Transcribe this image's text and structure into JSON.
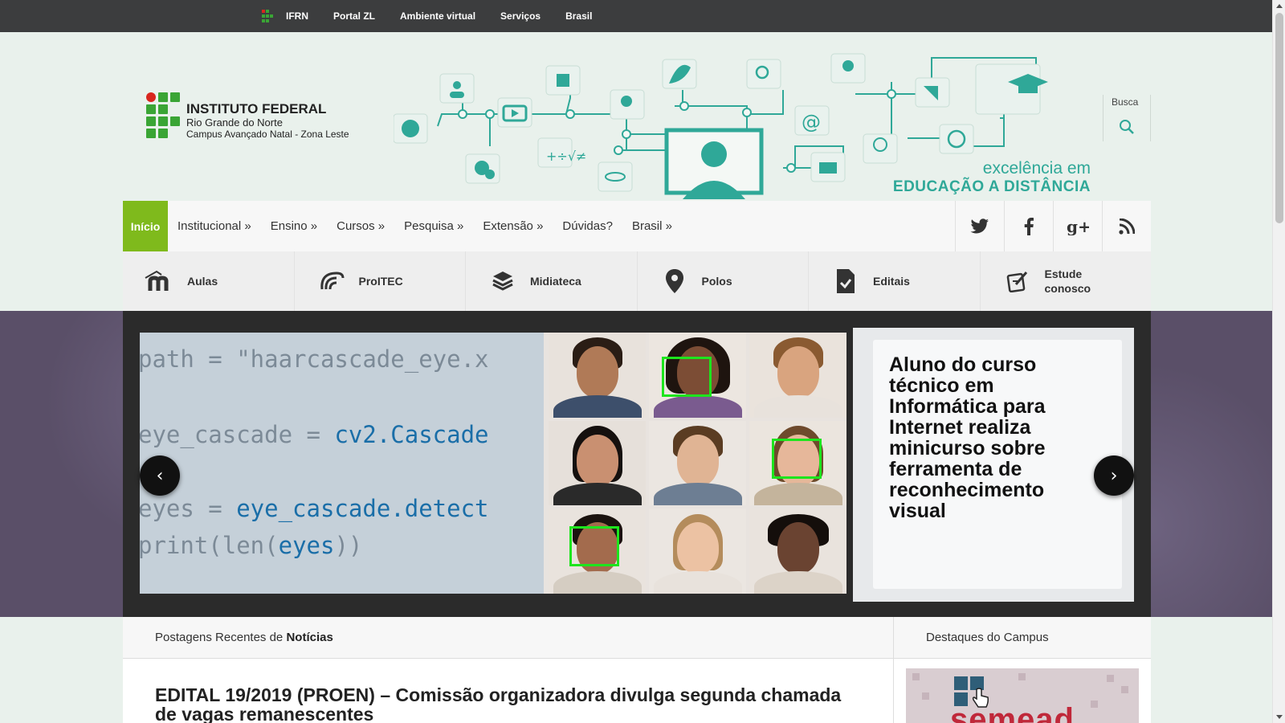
{
  "topbar": {
    "links": [
      "IFRN",
      "Portal ZL",
      "Ambiente virtual",
      "Serviços",
      "Brasil"
    ]
  },
  "brand": {
    "line1": "INSTITUTO FEDERAL",
    "line2": "Rio Grande do Norte",
    "line3": "Campus Avançado Natal - Zona Leste"
  },
  "banner": {
    "slogan_line1": "excelência em",
    "slogan_line2": "EDUCAÇÃO A DISTÂNCIA",
    "icons": [
      "globe-icon",
      "users-icon",
      "settings-icon",
      "video-icon",
      "puzzle-icon",
      "math-icon",
      "lightbulb-icon",
      "atom-icon",
      "leaf-icon",
      "computer-user-icon",
      "search-icon",
      "at-icon",
      "award-icon",
      "books-icon",
      "chat-icon",
      "rss-icon",
      "clock-icon",
      "graduation-cap-icon"
    ]
  },
  "search": {
    "label": "Busca",
    "icon": "search-icon"
  },
  "nav": {
    "home": "Início",
    "items": [
      "Institucional »",
      "Ensino »",
      "Cursos »",
      "Pesquisa »",
      "Extensão »",
      "Dúvidas?",
      "Brasil »"
    ],
    "social": [
      "twitter-icon",
      "facebook-icon",
      "google-plus-icon",
      "rss-icon"
    ],
    "home_color": "#7fba1c"
  },
  "quick_links": [
    {
      "label": "Aulas",
      "icon": "moodle-icon"
    },
    {
      "label": "ProITEC",
      "icon": "proitec-icon"
    },
    {
      "label": "Midiateca",
      "icon": "books-stack-icon"
    },
    {
      "label": "Polos",
      "icon": "map-pin-icon"
    },
    {
      "label": "Editais",
      "icon": "document-check-icon"
    },
    {
      "label": "Estude conosco",
      "icon": "pencil-note-icon"
    }
  ],
  "slider": {
    "code_lines": [
      {
        "plain": "path = \"haarcascade_eye.x",
        "blue": ""
      },
      {
        "plain": "eye_cascade = ",
        "blue": "cv2.Cascade"
      },
      {
        "plain": "eyes = ",
        "blue": "eye_cascade.detect"
      },
      {
        "plain": "print(len(",
        "blue": "eyes",
        "tail": "))"
      }
    ],
    "caption": "Aluno do curso técnico em Informática para Internet realiza minicurso sobre ferramenta de reconhecimento visual",
    "prev": "‹",
    "next": "›"
  },
  "content": {
    "header_prefix": "Postagens Recentes de ",
    "header_bold": "Notícias",
    "post_title": "EDITAL 19/2019 (PROEN) – Comissão organizadora divulga segunda chamada de vagas remanescentes"
  },
  "sidebar": {
    "title": "Destaques do Campus",
    "banner_text": "semead"
  },
  "colors": {
    "topbar": "#3c3d3e",
    "accent_teal": "#2fa898",
    "accent_green": "#7fba1c",
    "detect_box": "#1de51d"
  }
}
